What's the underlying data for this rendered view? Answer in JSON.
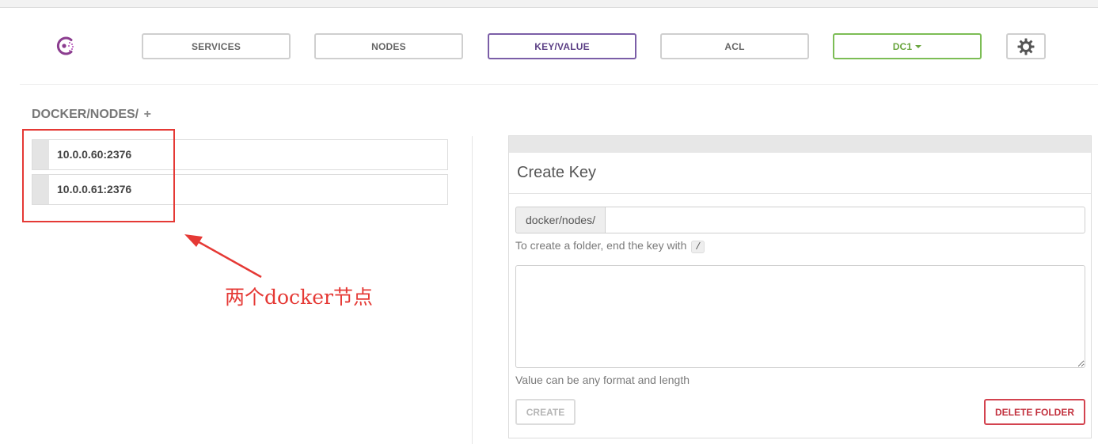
{
  "nav": {
    "logo_icon": "consul-logo-icon",
    "items": [
      {
        "label": "SERVICES"
      },
      {
        "label": "NODES"
      },
      {
        "label": "KEY/VALUE",
        "active": true
      },
      {
        "label": "ACL"
      }
    ],
    "datacenter": "DC1",
    "settings_icon": "gear-icon"
  },
  "breadcrumb": {
    "path": "DOCKER/NODES/",
    "add_symbol": "+"
  },
  "keys": [
    {
      "label": "10.0.0.60:2376"
    },
    {
      "label": "10.0.0.61:2376"
    }
  ],
  "annotation": {
    "text": "两个docker节点",
    "color": "#e53935"
  },
  "create_panel": {
    "title": "Create Key",
    "key_prefix": "docker/nodes/",
    "key_value": "",
    "folder_hint": "To create a folder, end the key with",
    "folder_hint_code": "/",
    "value_text": "",
    "value_hint": "Value can be any format and length",
    "create_label": "CREATE",
    "delete_label": "DELETE FOLDER"
  },
  "colors": {
    "accent": "#7b5ea7",
    "dc_green": "#7cbd55",
    "danger": "#d3434f"
  }
}
